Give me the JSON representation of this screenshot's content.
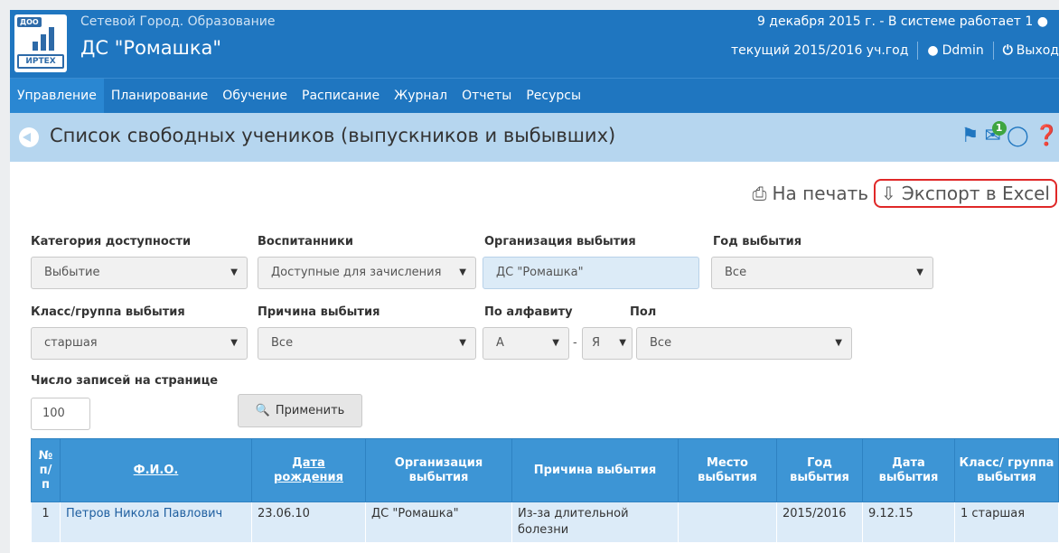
{
  "header": {
    "logo_top": "ДОО",
    "logo_bottom": "ИРТЕХ",
    "system_name": "Сетевой Город. Образование",
    "org_name": "ДС \"Ромашка\"",
    "status": "9 декабря 2015 г. - В системе работает 1",
    "year": "текущий 2015/2016 уч.год",
    "user": "Ddmin",
    "logout": "Выход"
  },
  "nav": {
    "items": [
      "Управление",
      "Планирование",
      "Обучение",
      "Расписание",
      "Журнал",
      "Отчеты",
      "Ресурсы"
    ],
    "active": "Управление"
  },
  "titlebar": {
    "title": "Список свободных учеников (выпускников и выбывших)",
    "badge": "1"
  },
  "actions": {
    "print": "На печать",
    "export": "Экспорт в Excel"
  },
  "filters": {
    "category_label": "Категория доступности",
    "category_value": "Выбытие",
    "pupils_label": "Воспитанники",
    "pupils_value": "Доступные для зачисления",
    "org_label": "Организация выбытия",
    "org_value": "ДС \"Ромашка\"",
    "year_label": "Год выбытия",
    "year_value": "Все",
    "class_label": "Класс/группа выбытия",
    "class_value": "старшая",
    "reason_label": "Причина выбытия",
    "reason_value": "Все",
    "alpha_label": "По алфавиту",
    "alpha_from": "А",
    "alpha_to": "Я",
    "gender_label": "Пол",
    "gender_value": "Все",
    "per_page_label": "Число записей на странице",
    "per_page_value": "100",
    "apply": "Применить"
  },
  "table": {
    "headers": [
      "№ п/ п",
      "Ф.И.О.",
      "Дата рождения",
      "Организация выбытия",
      "Причина выбытия",
      "Место выбытия",
      "Год выбытия",
      "Дата выбытия",
      "Класс/ группа выбытия"
    ],
    "rows": [
      [
        "1",
        "Петров Никола Павлович",
        "23.06.10",
        "ДС \"Ромашка\"",
        "Из-за длительной болезни",
        "",
        "2015/2016",
        "9.12.15",
        "1 старшая"
      ]
    ]
  }
}
